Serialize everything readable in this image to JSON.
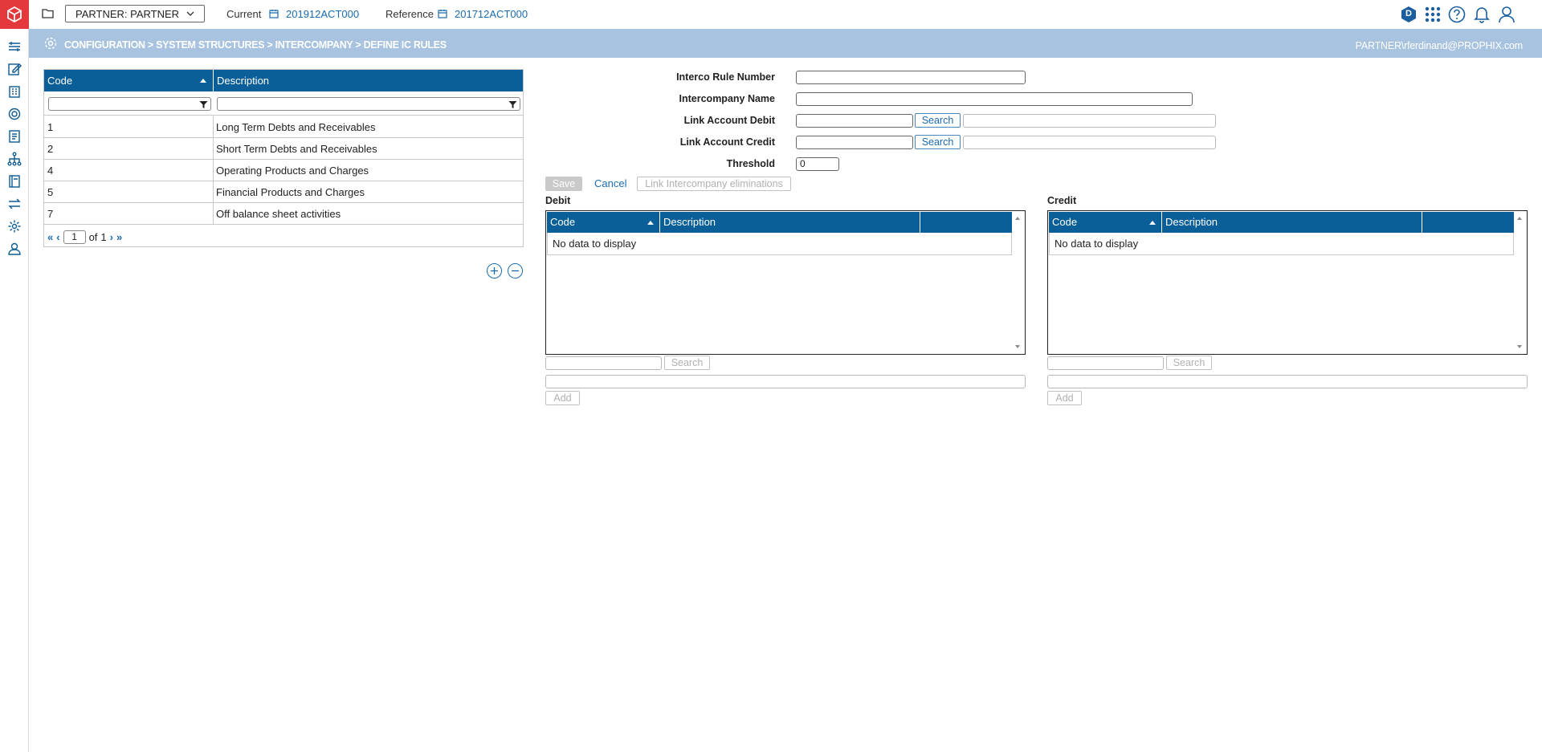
{
  "topbar": {
    "partner_select": "PARTNER: PARTNER",
    "current_label": "Current",
    "current_value": "201912ACT000",
    "reference_label": "Reference",
    "reference_value": "201712ACT000",
    "badge_letter": "D"
  },
  "breadcrumb": {
    "path": "CONFIGURATION > SYSTEM STRUCTURES > INTERCOMPANY > DEFINE IC RULES",
    "user": "PARTNER\\rferdinand@PROPHIX.com"
  },
  "rules_grid": {
    "columns": [
      "Code",
      "Description"
    ],
    "rows": [
      {
        "code": "1",
        "description": "Long Term Debts and Receivables"
      },
      {
        "code": "2",
        "description": "Short Term Debts and Receivables"
      },
      {
        "code": "4",
        "description": "Operating Products and Charges"
      },
      {
        "code": "5",
        "description": "Financial Products and Charges"
      },
      {
        "code": "7",
        "description": "Off balance sheet activities"
      }
    ],
    "pager": {
      "page": "1",
      "of_label": "of",
      "total": "1"
    }
  },
  "form": {
    "interco_rule_number_label": "Interco Rule Number",
    "intercompany_name_label": "Intercompany Name",
    "link_account_debit_label": "Link Account Debit",
    "link_account_credit_label": "Link Account Credit",
    "threshold_label": "Threshold",
    "threshold_value": "0",
    "search_label": "Search",
    "save_label": "Save",
    "cancel_label": "Cancel",
    "link_elim_label": "Link Intercompany eliminations"
  },
  "debit": {
    "title": "Debit",
    "columns": [
      "Code",
      "Description"
    ],
    "empty_text": "No data to display",
    "search_label": "Search",
    "add_label": "Add"
  },
  "credit": {
    "title": "Credit",
    "columns": [
      "Code",
      "Description"
    ],
    "empty_text": "No data to display",
    "search_label": "Search",
    "add_label": "Add"
  },
  "colors": {
    "header_blue": "#0b5f99",
    "crumb_bar": "#a7c3df",
    "link_blue": "#1a6bb0",
    "logo_red": "#e5383b"
  }
}
